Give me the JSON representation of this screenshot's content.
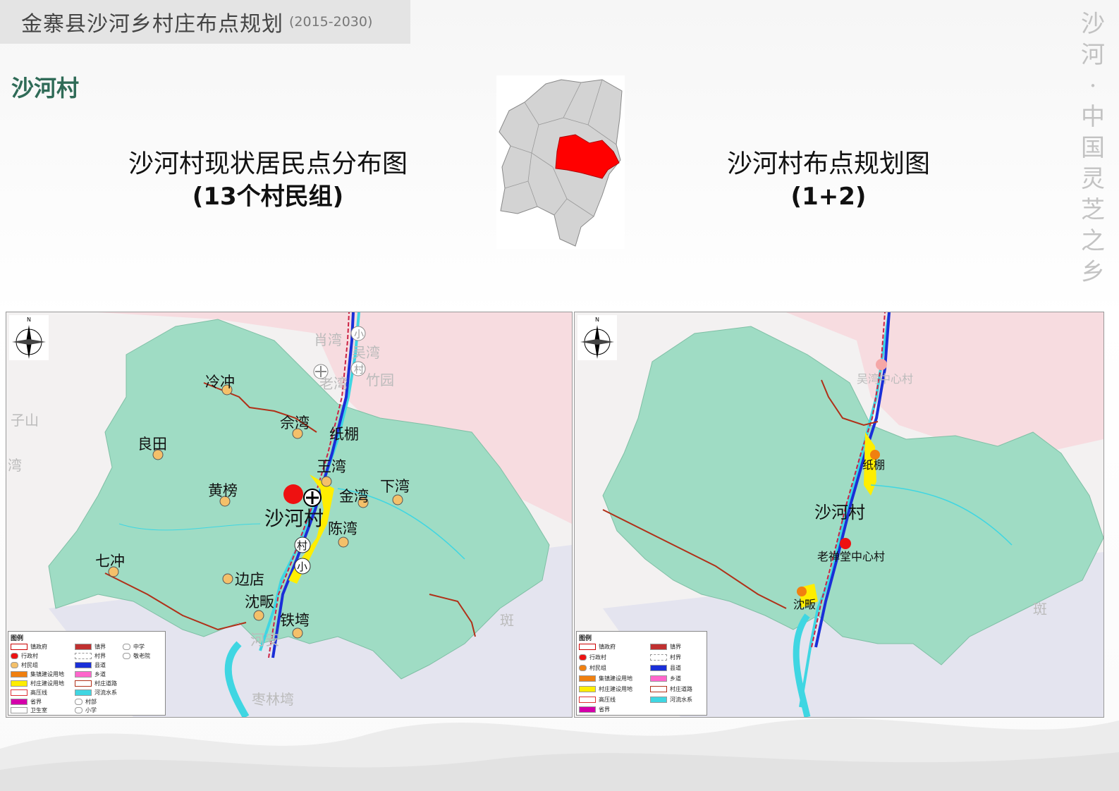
{
  "header": {
    "title": "金寨县沙河乡村庄布点规划",
    "years": "(2015-2030)"
  },
  "section": {
    "village_name": "沙河村"
  },
  "slogan": [
    "沙",
    "河",
    "·",
    "中",
    "国",
    "灵",
    "芝",
    "之",
    "乡"
  ],
  "left_map": {
    "title": "沙河村现状居民点分布图",
    "subtitle": "(13个村民组)",
    "labels": {
      "xiaowan": "肖湾",
      "xiao_top": "小",
      "wuwan": "吴湾",
      "cun_top": "村",
      "laowan": "老湾",
      "zhuyuan": "竹园",
      "lengchong": "冷冲",
      "yuwan": "佘湾",
      "zhipeng": "纸棚",
      "liangtian": "良田",
      "wangwan": "王湾",
      "huangbang": "黄榜",
      "xiawan": "下湾",
      "jinwan": "金湾",
      "shahecun": "沙河村",
      "chenwan": "陈湾",
      "cun_badge": "村",
      "xiao_badge": "小",
      "qichong": "七冲",
      "biandian": "边店",
      "shenfan": "沈畈",
      "tiewan": "铁塆",
      "hean": "河安",
      "zaolinwan": "枣林塆",
      "ban": "斑",
      "zishan": "子山",
      "wan_left": "湾"
    },
    "legend": {
      "title": "图例",
      "items": [
        "镇政府",
        "行政村",
        "村民组",
        "集镇建设用地",
        "村庄建设用地",
        "高压线",
        "省界",
        "卫生室",
        "镇界",
        "村界",
        "县道",
        "乡道",
        "村庄道路",
        "河流水系",
        "村部",
        "小学",
        "中学",
        "敬老院"
      ]
    }
  },
  "right_map": {
    "title": "沙河村布点规划图",
    "subtitle": "(1+2)",
    "labels": {
      "wuwan_center": "吴湾中心村",
      "zhipeng": "纸棚",
      "shahecun": "沙河村",
      "laochantang": "老禅堂中心村",
      "shenfan": "沈畈",
      "ban": "斑"
    },
    "legend": {
      "title": "图例",
      "items": [
        "镇政府",
        "行政村",
        "村民组",
        "集镇建设用地",
        "村庄建设用地",
        "高压线",
        "省界",
        "镇界",
        "村界",
        "县道",
        "乡道",
        "村庄道路",
        "河流水系"
      ]
    }
  },
  "colors": {
    "territory": "#9fdcc4",
    "neighbor": "#f7dce0",
    "outside": "#f2f2f2",
    "highlight_region": "#ff0000",
    "county_road": "#1a2fd8",
    "village_road": "#b03018",
    "river": "#3fd6e2",
    "construction": "#ffee00",
    "village_dot": "#f4c06a"
  },
  "compass_label": "N"
}
